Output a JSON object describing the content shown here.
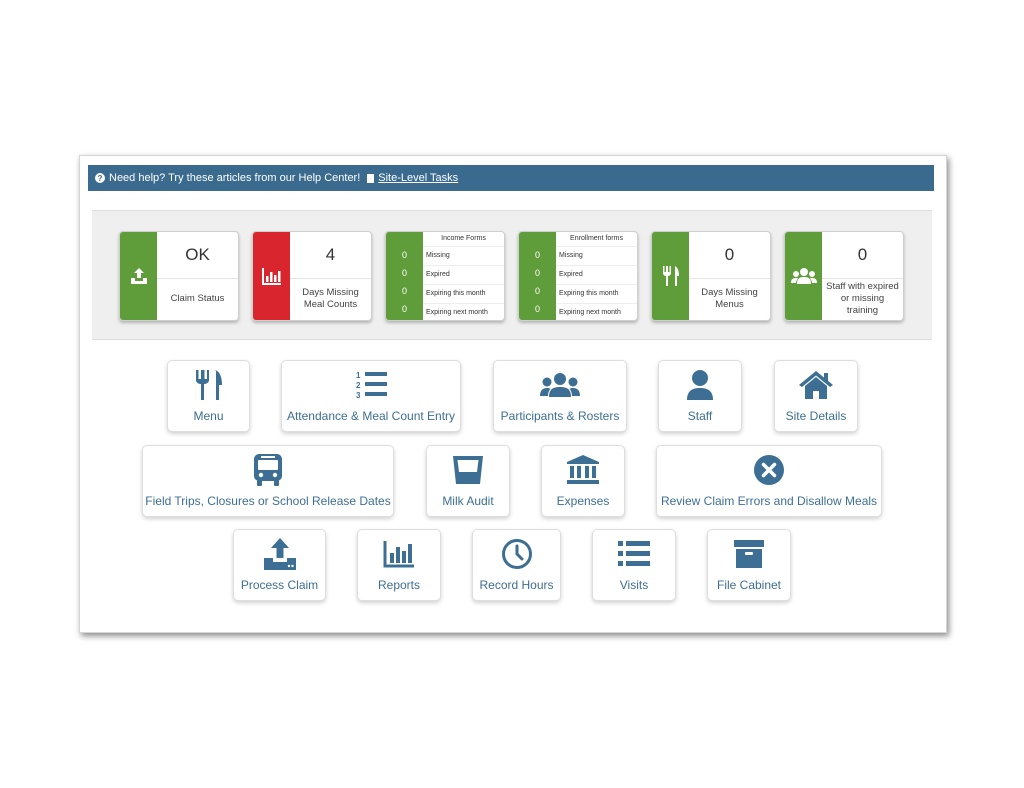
{
  "help": {
    "text": "Need help? Try these articles from our Help Center!",
    "link": "Site-Level Tasks"
  },
  "stats": {
    "claim_status": {
      "value": "OK",
      "label": "Claim Status",
      "icon": "upload-tray-icon"
    },
    "days_missing_meal_counts": {
      "value": "4",
      "label": "Days Missing Meal Counts",
      "icon": "bar-chart-icon"
    },
    "income_forms": {
      "title": "Income Forms",
      "rows": [
        {
          "count": "0",
          "label": "Missing"
        },
        {
          "count": "0",
          "label": "Expired"
        },
        {
          "count": "0",
          "label": "Expiring this month"
        },
        {
          "count": "0",
          "label": "Expiring next month"
        }
      ]
    },
    "enrollment_forms": {
      "title": "Enrollment forms",
      "rows": [
        {
          "count": "0",
          "label": "Missing"
        },
        {
          "count": "0",
          "label": "Expired"
        },
        {
          "count": "0",
          "label": "Expiring this month"
        },
        {
          "count": "0",
          "label": "Expiring next month"
        }
      ]
    },
    "days_missing_menus": {
      "value": "0",
      "label": "Days Missing Menus",
      "icon": "utensils-icon"
    },
    "staff_training": {
      "value": "0",
      "label": "Staff with expired or missing training",
      "icon": "users-icon"
    }
  },
  "tiles": {
    "menu": "Menu",
    "attendance": "Attendance & Meal Count Entry",
    "participants": "Participants & Rosters",
    "staff": "Staff",
    "site_details": "Site Details",
    "field_trips": "Field Trips, Closures or School Release Dates",
    "milk_audit": "Milk Audit",
    "expenses": "Expenses",
    "review_claim": "Review Claim Errors and Disallow Meals",
    "process_claim": "Process Claim",
    "reports": "Reports",
    "record_hours": "Record Hours",
    "visits": "Visits",
    "file_cabinet": "File Cabinet"
  },
  "colors": {
    "accent": "#3a6b8f",
    "ok_green": "#5f9d3a",
    "alert_red": "#d9262e",
    "icon_blue": "#3d6f94"
  }
}
